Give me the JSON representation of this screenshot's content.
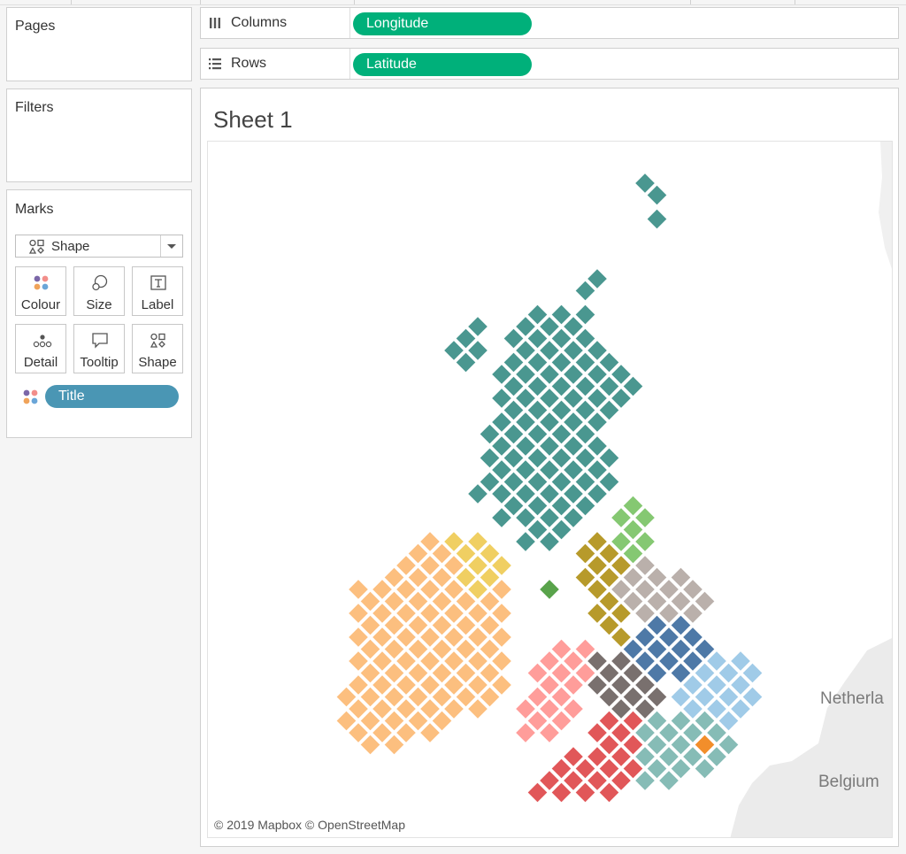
{
  "pages": {
    "title": "Pages"
  },
  "filters": {
    "title": "Filters"
  },
  "marks": {
    "title": "Marks",
    "mark_type": "Shape",
    "buttons": [
      "Colour",
      "Size",
      "Label",
      "Detail",
      "Tooltip",
      "Shape"
    ],
    "colour_field": "Title"
  },
  "shelves": {
    "columns": {
      "label": "Columns",
      "field": "Longitude"
    },
    "rows": {
      "label": "Rows",
      "field": "Latitude"
    }
  },
  "sheet": {
    "title": "Sheet 1",
    "attribution": "© 2019 Mapbox © OpenStreetMap",
    "map_labels": {
      "netherlands": "Netherla",
      "belgium": "Belgium"
    }
  },
  "colors": {
    "pill_green": "#00b07a",
    "pill_blue": "#4a96b4",
    "scotland": "#4a9790",
    "ireland_orange": "#fcbf7f",
    "ireland_yellow": "#f0cf62",
    "northern_england_green": "#85c872",
    "isle_of_man": "#59a34b",
    "north_west_gold": "#b79a2b",
    "north_east_grey": "#bab0ab",
    "midlands_blue": "#4e79a7",
    "east_light_blue": "#a0cbe8",
    "wales_pink": "#ff9d9a",
    "west_midlands_dark": "#79706e",
    "south_west_red": "#e15759",
    "south_east_teal": "#86bcb6",
    "london_orange": "#f28e2b"
  }
}
